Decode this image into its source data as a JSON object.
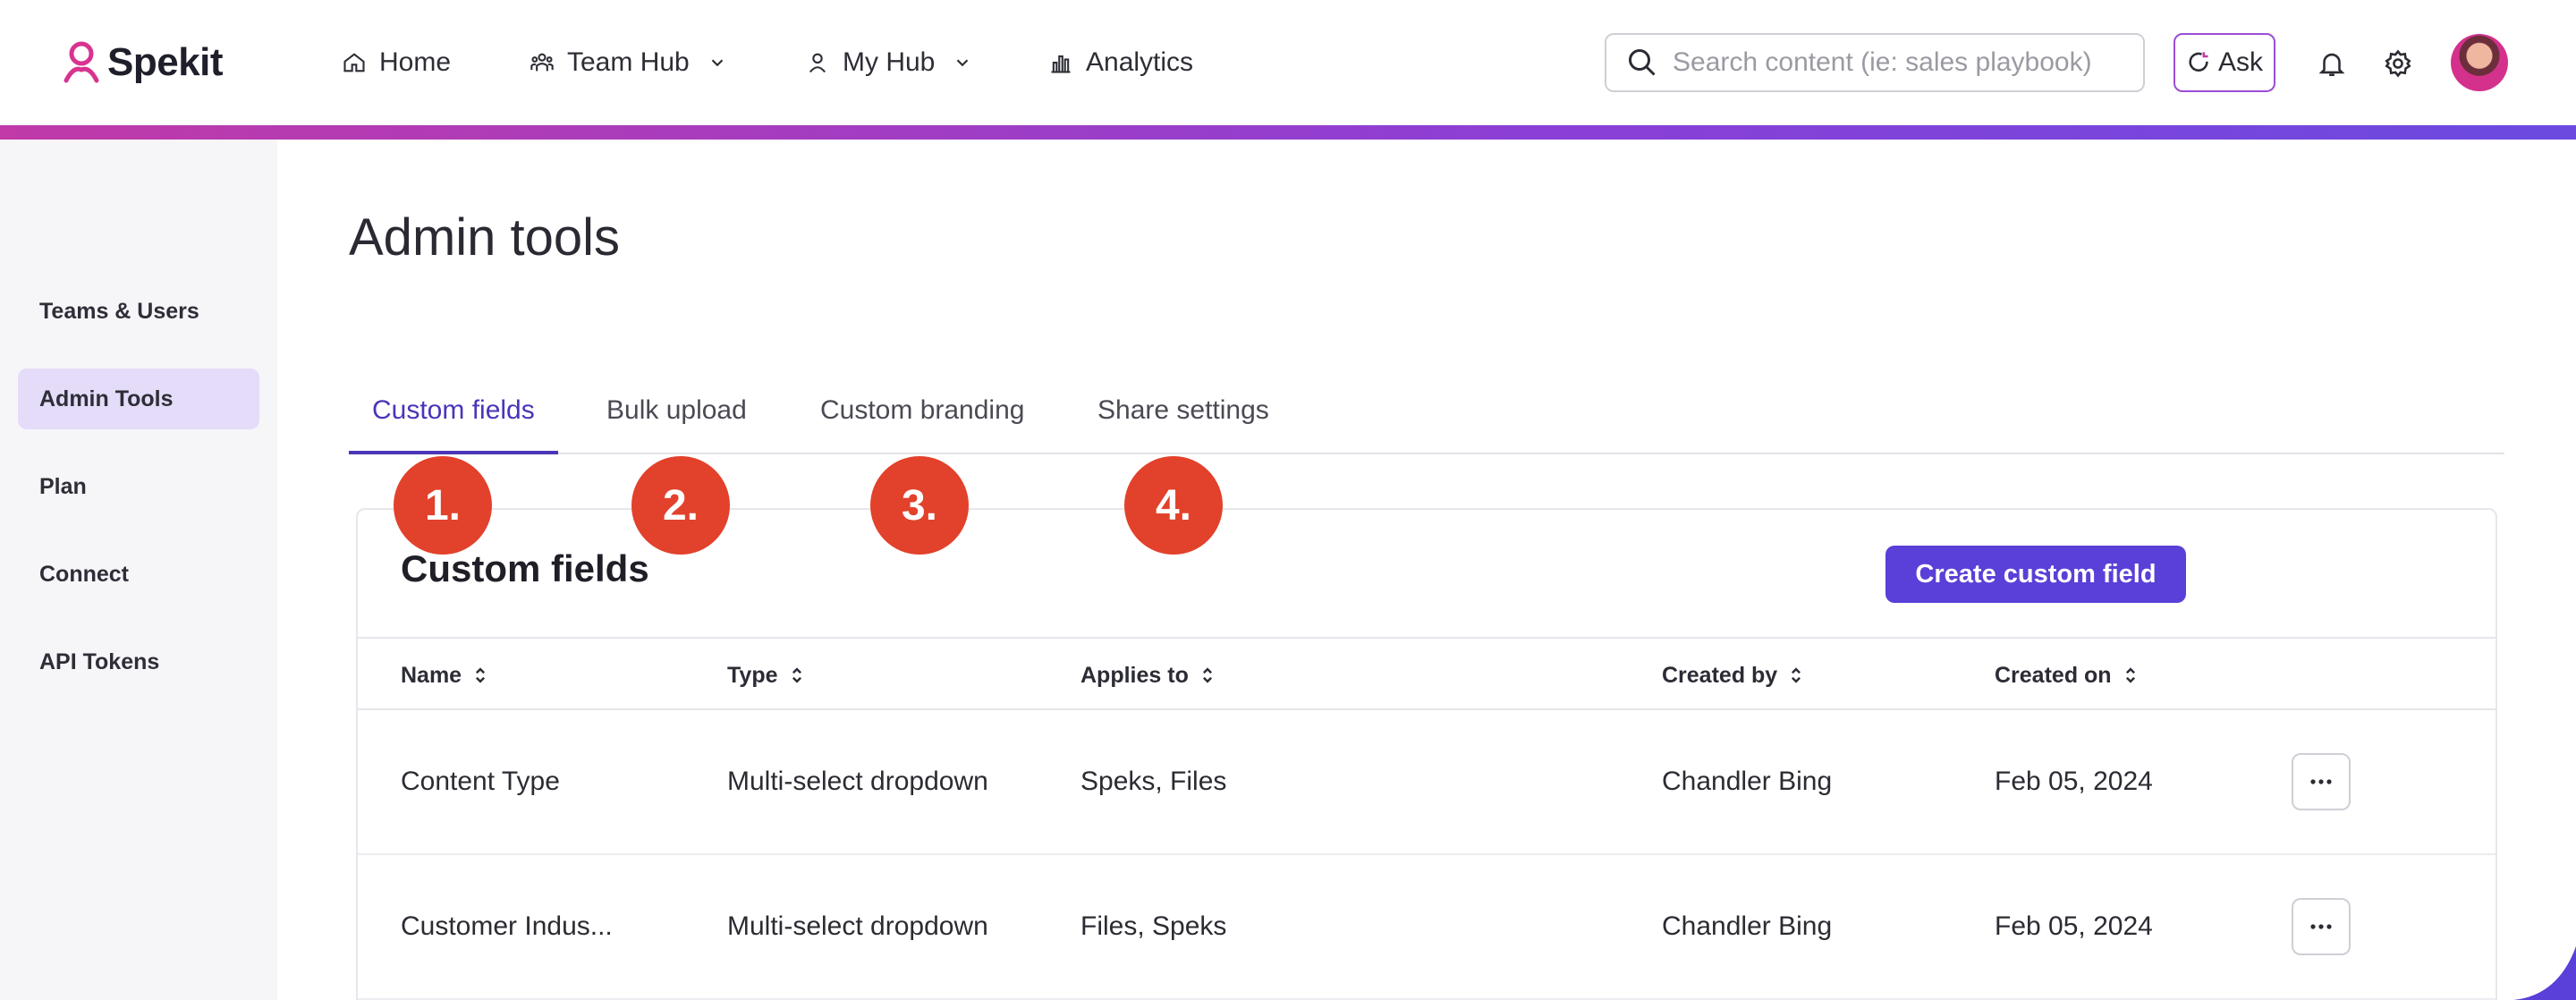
{
  "brand": {
    "name": "Spekit",
    "accent": "#5a3fd8",
    "marker_color": "#e2412b"
  },
  "nav": {
    "items": [
      {
        "label": "Home",
        "icon": "home-icon"
      },
      {
        "label": "Team Hub",
        "icon": "team-icon",
        "has_dropdown": true
      },
      {
        "label": "My Hub",
        "icon": "user-icon",
        "has_dropdown": true
      },
      {
        "label": "Analytics",
        "icon": "analytics-icon"
      }
    ],
    "search_placeholder": "Search content (ie: sales playbook)",
    "ask_label": "Ask"
  },
  "sidebar": {
    "items": [
      {
        "label": "Teams & Users",
        "active": false
      },
      {
        "label": "Admin Tools",
        "active": true
      },
      {
        "label": "Plan",
        "active": false
      },
      {
        "label": "Connect",
        "active": false
      },
      {
        "label": "API Tokens",
        "active": false
      }
    ]
  },
  "page": {
    "title": "Admin tools",
    "tabs": [
      {
        "label": "Custom fields",
        "active": true
      },
      {
        "label": "Bulk upload",
        "active": false
      },
      {
        "label": "Custom branding",
        "active": false
      },
      {
        "label": "Share settings",
        "active": false
      }
    ],
    "markers": [
      "1.",
      "2.",
      "3.",
      "4."
    ]
  },
  "card": {
    "title": "Custom fields",
    "create_label": "Create custom field",
    "columns": [
      "Name",
      "Type",
      "Applies to",
      "Created by",
      "Created on"
    ],
    "rows": [
      {
        "name": "Content Type",
        "type": "Multi-select dropdown",
        "applies_to": "Speks, Files",
        "created_by": "Chandler Bing",
        "created_on": "Feb 05, 2024"
      },
      {
        "name": "Customer Indus...",
        "type": "Multi-select dropdown",
        "applies_to": "Files, Speks",
        "created_by": "Chandler Bing",
        "created_on": "Feb 05, 2024"
      }
    ]
  }
}
